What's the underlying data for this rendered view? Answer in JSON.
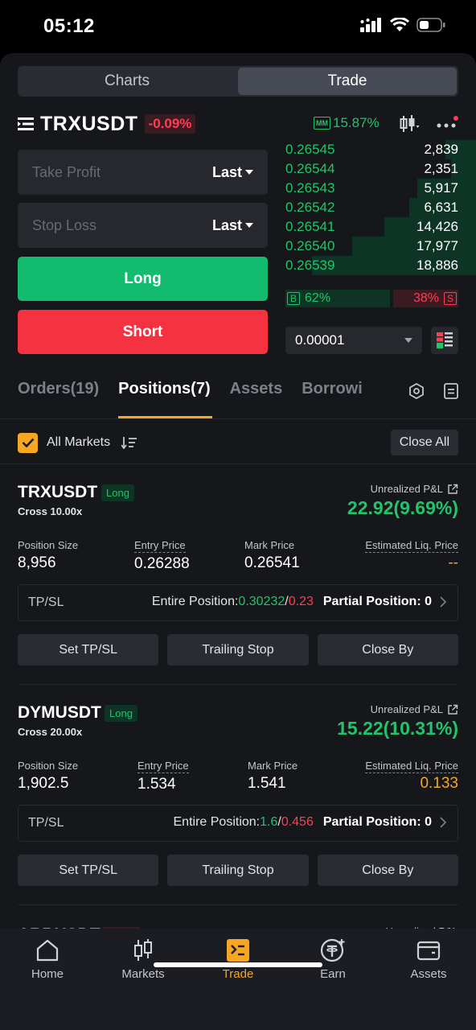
{
  "status_bar": {
    "time": "05:12"
  },
  "segment": {
    "charts": "Charts",
    "trade": "Trade"
  },
  "pair": {
    "symbol": "TRXUSDT",
    "change": "-0.09%",
    "mm_icon": "MM",
    "mm_value": "15.87%"
  },
  "order_form": {
    "take_profit_placeholder": "Take Profit",
    "take_profit_type": "Last",
    "stop_loss_placeholder": "Stop Loss",
    "stop_loss_type": "Last",
    "long_label": "Long",
    "short_label": "Short"
  },
  "order_book": {
    "bids": [
      {
        "price": "0.26545",
        "qty": "2,839",
        "depth": 0.16
      },
      {
        "price": "0.26544",
        "qty": "2,351",
        "depth": 0.13
      },
      {
        "price": "0.26543",
        "qty": "5,917",
        "depth": 0.31
      },
      {
        "price": "0.26542",
        "qty": "6,631",
        "depth": 0.35
      },
      {
        "price": "0.26541",
        "qty": "14,426",
        "depth": 0.48
      },
      {
        "price": "0.26540",
        "qty": "17,977",
        "depth": 0.65
      },
      {
        "price": "0.26539",
        "qty": "18,886",
        "depth": 0.86
      }
    ],
    "buy_tag": "B",
    "buy_ratio": "62%",
    "sell_ratio": "38%",
    "sell_tag": "S",
    "precision": "0.00001"
  },
  "tabs": {
    "orders": "Orders(19)",
    "positions": "Positions(7)",
    "assets": "Assets",
    "borrowing": "Borrowi"
  },
  "filter": {
    "all_markets": "All Markets",
    "close_all": "Close All"
  },
  "positions": [
    {
      "symbol": "TRXUSDT",
      "side": "Long",
      "margin": "Cross 10.00x",
      "upnl_label": "Unrealized P&L",
      "upnl": "22.92(9.69%)",
      "size_label": "Position Size",
      "size": "8,956",
      "entry_label": "Entry Price",
      "entry": "0.26288",
      "mark_label": "Mark Price",
      "mark": "0.26541",
      "liq_label": "Estimated Liq. Price",
      "liq": "--",
      "tpsl_label": "TP/SL",
      "entire_label": "Entire Position: ",
      "tp": "0.30232",
      "slash": "/",
      "sl": "0.23",
      "partial": "Partial Position: 0",
      "set_tpsl": "Set TP/SL",
      "trailing": "Trailing Stop",
      "close_by": "Close By"
    },
    {
      "symbol": "DYMUSDT",
      "side": "Long",
      "margin": "Cross 20.00x",
      "upnl_label": "Unrealized P&L",
      "upnl": "15.22(10.31%)",
      "size_label": "Position Size",
      "size": "1,902.5",
      "entry_label": "Entry Price",
      "entry": "1.534",
      "mark_label": "Mark Price",
      "mark": "1.541",
      "liq_label": "Estimated Liq. Price",
      "liq": "0.133",
      "tpsl_label": "TP/SL",
      "entire_label": "Entire Position: ",
      "tp": "1.6",
      "slash": "/",
      "sl": "0.456",
      "partial": "Partial Position: 0",
      "set_tpsl": "Set TP/SL",
      "trailing": "Trailing Stop",
      "close_by": "Close By"
    }
  ],
  "partial_card": {
    "symbol": "ARBUSDT",
    "upnl_label": "Unrealized P&L"
  },
  "nav": {
    "home": "Home",
    "markets": "Markets",
    "trade": "Trade",
    "earn": "Earn",
    "assets": "Assets"
  },
  "colors": {
    "green": "#22c46b",
    "red": "#ff3d54",
    "accent": "#f5a623",
    "long_button": "#12bb6d",
    "short_button": "#f5323f"
  }
}
